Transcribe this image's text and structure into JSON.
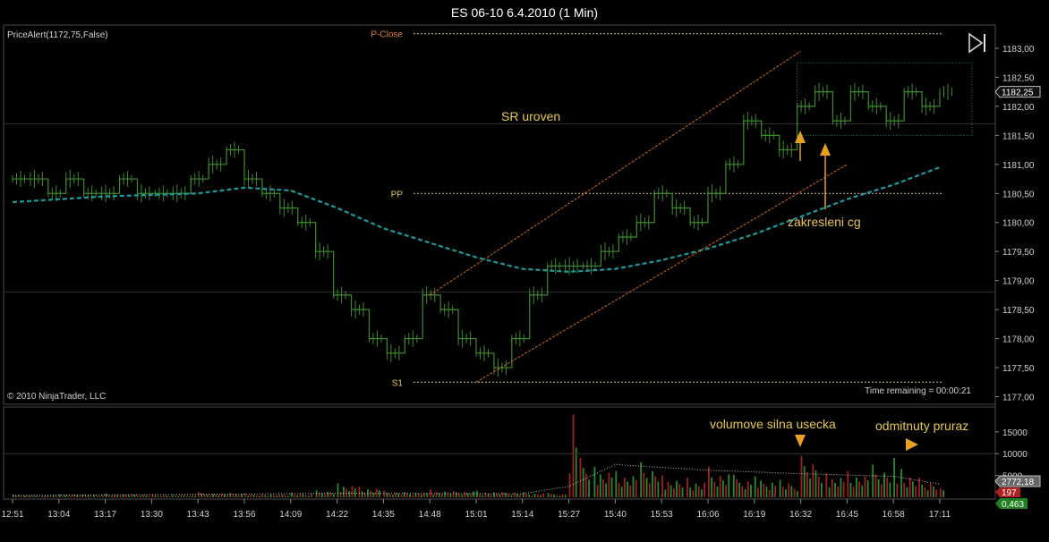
{
  "window": {
    "title": "ES 06-10  6.4.2010 (1 Min)"
  },
  "indicator_label": "PriceAlert(1172,75,False)",
  "copyright": "© 2010 NinjaTrader, LLC",
  "time_remaining": "Time remaining = 00:00:21",
  "annotations": {
    "sr_level": "SR uroven",
    "cg_drawing": "zakresleni cg",
    "volume_strong_bar": "volumove silna usecka",
    "rejected_breakout": "odmitnuty pruraz"
  },
  "colors": {
    "background": "#000000",
    "price_bar": "#3c8c2c",
    "moving_average": "#1a9a9a",
    "level_line": "#d8c8a0",
    "trend_line": "#d06828",
    "arrow": "#e8a020",
    "volume_up": "#2a8a2a",
    "volume_down": "#a02020",
    "last_price_box": "#c0c0c0",
    "volume_value_box": "#b02020",
    "volume_ma_box": "#208020"
  },
  "chart_data": {
    "type": "line",
    "price_axis": {
      "ylim": [
        1176.9,
        1183.4
      ],
      "ticks": [
        "1177,00",
        "1177,50",
        "1178,00",
        "1178,50",
        "1179,00",
        "1179,50",
        "1180,00",
        "1180,50",
        "1181,00",
        "1181,50",
        "1182,00",
        "1182,50",
        "1183,00"
      ],
      "tick_values": [
        1177.0,
        1177.5,
        1178.0,
        1178.5,
        1179.0,
        1179.5,
        1180.0,
        1180.5,
        1181.0,
        1181.5,
        1182.0,
        1182.5,
        1183.0
      ],
      "last_price": "1182,25",
      "last_price_value": 1182.25
    },
    "time_axis": {
      "labels": [
        "12:51",
        "13:04",
        "13:17",
        "13:30",
        "13:43",
        "13:56",
        "14:09",
        "14:22",
        "14:35",
        "14:48",
        "15:01",
        "15:14",
        "15:27",
        "15:40",
        "15:53",
        "16:06",
        "16:19",
        "16:32",
        "16:45",
        "16:58",
        "17:11"
      ]
    },
    "levels": [
      {
        "name": "P-Close",
        "value": 1183.25
      },
      {
        "name": "PP",
        "value": 1180.5
      },
      {
        "name": "S1",
        "value": 1177.25
      }
    ],
    "price_series": [
      [
        "12:51",
        1180.75
      ],
      [
        "12:56",
        1180.75
      ],
      [
        "13:01",
        1180.5
      ],
      [
        "13:06",
        1180.75
      ],
      [
        "13:11",
        1180.5
      ],
      [
        "13:16",
        1180.5
      ],
      [
        "13:21",
        1180.75
      ],
      [
        "13:26",
        1180.5
      ],
      [
        "13:31",
        1180.5
      ],
      [
        "13:36",
        1180.5
      ],
      [
        "13:41",
        1180.75
      ],
      [
        "13:46",
        1181.0
      ],
      [
        "13:51",
        1181.25
      ],
      [
        "13:56",
        1180.75
      ],
      [
        "14:01",
        1180.5
      ],
      [
        "14:06",
        1180.25
      ],
      [
        "14:11",
        1180.0
      ],
      [
        "14:16",
        1179.5
      ],
      [
        "14:21",
        1178.75
      ],
      [
        "14:26",
        1178.5
      ],
      [
        "14:31",
        1178.0
      ],
      [
        "14:36",
        1177.75
      ],
      [
        "14:41",
        1178.0
      ],
      [
        "14:46",
        1178.75
      ],
      [
        "14:51",
        1178.5
      ],
      [
        "14:56",
        1178.0
      ],
      [
        "15:01",
        1177.75
      ],
      [
        "15:06",
        1177.5
      ],
      [
        "15:11",
        1178.0
      ],
      [
        "15:16",
        1178.75
      ],
      [
        "15:21",
        1179.25
      ],
      [
        "15:26",
        1179.25
      ],
      [
        "15:31",
        1179.25
      ],
      [
        "15:36",
        1179.5
      ],
      [
        "15:41",
        1179.75
      ],
      [
        "15:46",
        1180.0
      ],
      [
        "15:51",
        1180.5
      ],
      [
        "15:56",
        1180.25
      ],
      [
        "16:01",
        1180.0
      ],
      [
        "16:06",
        1180.5
      ],
      [
        "16:11",
        1181.0
      ],
      [
        "16:16",
        1181.75
      ],
      [
        "16:21",
        1181.5
      ],
      [
        "16:26",
        1181.25
      ],
      [
        "16:31",
        1182.0
      ],
      [
        "16:36",
        1182.25
      ],
      [
        "16:41",
        1181.75
      ],
      [
        "16:46",
        1182.25
      ],
      [
        "16:51",
        1182.0
      ],
      [
        "16:56",
        1181.75
      ],
      [
        "17:01",
        1182.25
      ],
      [
        "17:06",
        1182.0
      ],
      [
        "17:11",
        1182.25
      ]
    ],
    "moving_average": [
      [
        "12:51",
        1180.35
      ],
      [
        "13:17",
        1180.45
      ],
      [
        "13:43",
        1180.5
      ],
      [
        "13:56",
        1180.6
      ],
      [
        "14:09",
        1180.55
      ],
      [
        "14:22",
        1180.25
      ],
      [
        "14:35",
        1179.9
      ],
      [
        "14:48",
        1179.65
      ],
      [
        "15:01",
        1179.4
      ],
      [
        "15:14",
        1179.2
      ],
      [
        "15:27",
        1179.15
      ],
      [
        "15:40",
        1179.2
      ],
      [
        "15:53",
        1179.35
      ],
      [
        "16:06",
        1179.55
      ],
      [
        "16:19",
        1179.8
      ],
      [
        "16:32",
        1180.1
      ],
      [
        "16:45",
        1180.4
      ],
      [
        "16:58",
        1180.65
      ],
      [
        "17:11",
        1180.95
      ]
    ],
    "trend_lines": [
      {
        "from": [
          "14:48",
          1178.75
        ],
        "to": [
          "16:32",
          1182.95
        ]
      },
      {
        "from": [
          "15:01",
          1177.25
        ],
        "to": [
          "16:45",
          1181.0
        ]
      }
    ],
    "range_box": {
      "time_start": "16:32",
      "time_end": "17:19",
      "high": 1182.75,
      "low": 1181.5
    },
    "volume": {
      "axis_ticks": [
        "5000",
        "10000",
        "15000"
      ],
      "tick_values": [
        5000,
        10000,
        15000
      ],
      "ylim": [
        0,
        20500
      ],
      "last_volume": "197",
      "volume_ma": "2772,18",
      "extra_value": "0,463",
      "bars": [
        [
          "12:51",
          600
        ],
        [
          "13:04",
          700
        ],
        [
          "13:17",
          900
        ],
        [
          "13:30",
          700
        ],
        [
          "13:43",
          1200
        ],
        [
          "13:56",
          900
        ],
        [
          "14:09",
          1100
        ],
        [
          "14:16",
          1600
        ],
        [
          "14:22",
          3200
        ],
        [
          "14:28",
          2500
        ],
        [
          "14:35",
          1500
        ],
        [
          "14:48",
          1800
        ],
        [
          "15:01",
          1500
        ],
        [
          "15:14",
          1200
        ],
        [
          "15:21",
          1000
        ],
        [
          "15:27",
          5500
        ],
        [
          "15:28",
          19000
        ],
        [
          "15:30",
          9000
        ],
        [
          "15:34",
          7000
        ],
        [
          "15:40",
          6000
        ],
        [
          "15:47",
          8000
        ],
        [
          "15:53",
          5000
        ],
        [
          "16:00",
          4500
        ],
        [
          "16:06",
          7000
        ],
        [
          "16:13",
          5200
        ],
        [
          "16:19",
          4800
        ],
        [
          "16:26",
          4000
        ],
        [
          "16:32",
          9500
        ],
        [
          "16:39",
          5500
        ],
        [
          "16:45",
          6000
        ],
        [
          "16:52",
          7500
        ],
        [
          "16:58",
          9000
        ],
        [
          "17:00",
          6500
        ],
        [
          "17:05",
          4500
        ],
        [
          "17:11",
          2000
        ]
      ]
    }
  }
}
